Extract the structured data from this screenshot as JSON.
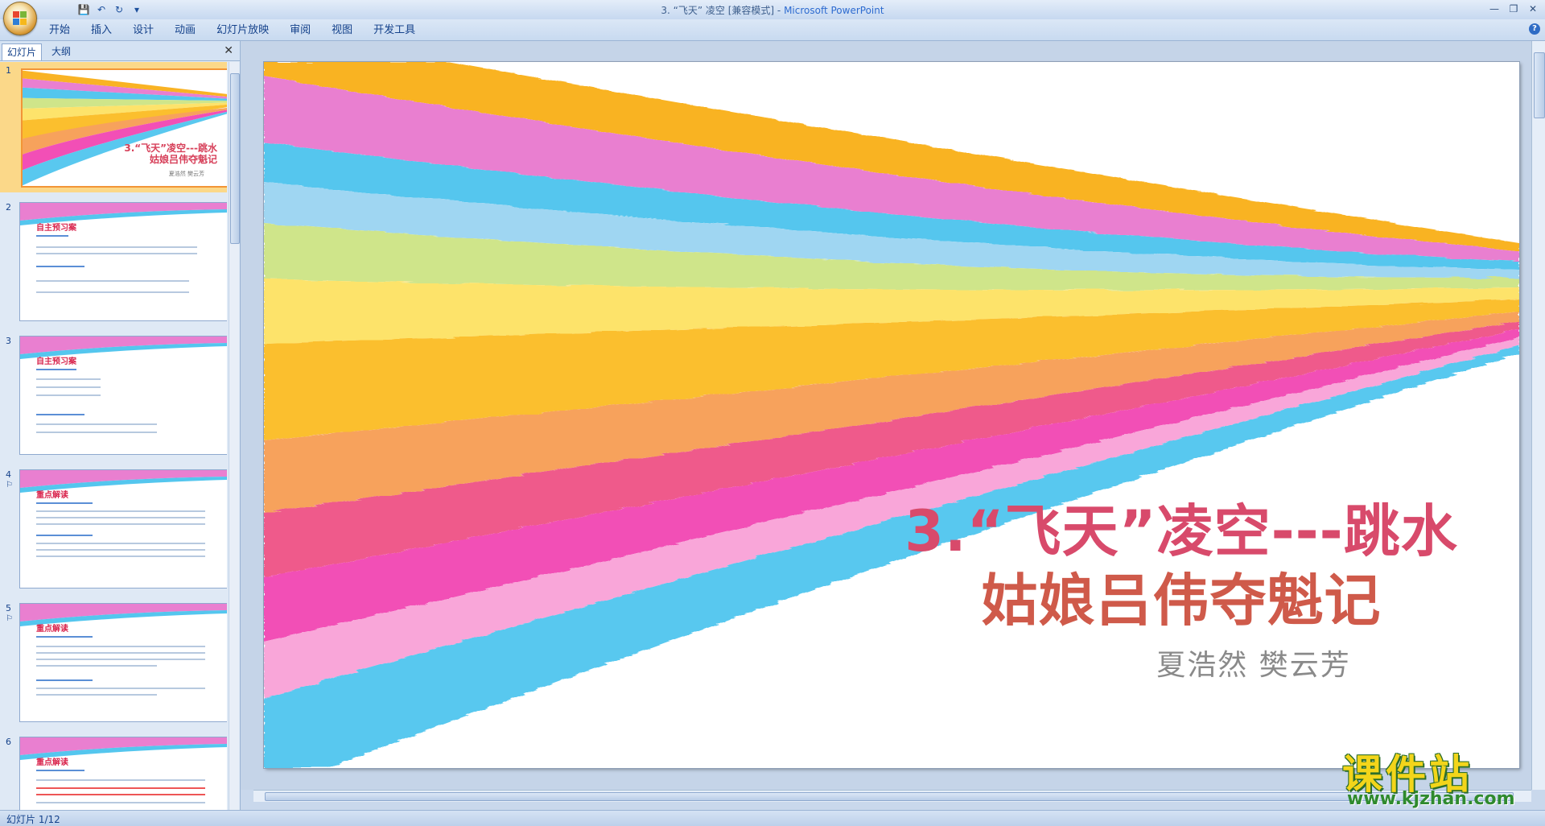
{
  "window": {
    "title_doc": "3. “飞天” 凌空 [兼容模式]",
    "title_sep": " - ",
    "title_app": "Microsoft PowerPoint",
    "minimize_glyph": "—",
    "restore_glyph": "❐",
    "close_glyph": "✕"
  },
  "qat": {
    "save_glyph": "💾",
    "undo_glyph": "↶",
    "redo_glyph": "↻",
    "customize_glyph": "▾"
  },
  "ribbon": {
    "tabs": [
      {
        "label": "开始"
      },
      {
        "label": "插入"
      },
      {
        "label": "设计"
      },
      {
        "label": "动画"
      },
      {
        "label": "幻灯片放映"
      },
      {
        "label": "审阅"
      },
      {
        "label": "视图"
      },
      {
        "label": "开发工具"
      }
    ],
    "help_glyph": "?"
  },
  "left_panel": {
    "tab_slides": "幻灯片",
    "tab_outline": "大纲",
    "close_glyph": "✕",
    "slides": [
      {
        "num": "1",
        "title": "3.“飞天”凌空---跳水",
        "title2": "姑娘吕伟夺魁记",
        "sub": "夏浩然  樊云芳"
      },
      {
        "num": "2",
        "title": "自主预习案"
      },
      {
        "num": "3",
        "title": "自主预习案"
      },
      {
        "num": "4",
        "note": "⚐",
        "title": "重点解读"
      },
      {
        "num": "5",
        "note": "⚐",
        "title": "重点解读"
      },
      {
        "num": "6",
        "title": "重点解读"
      }
    ]
  },
  "slide": {
    "title_line1": "3.“飞天”凌空---跳水",
    "title_line2": "姑娘吕伟夺魁记",
    "authors": "夏浩然  樊云芳"
  },
  "statusbar": {
    "text": "幻灯片 1/12"
  },
  "watermark": {
    "main": "课件站",
    "url": "www.kjzhan.com"
  },
  "colors": {
    "ribbon_bg": "#c8daf0",
    "selected_thumb_border": "#f29536",
    "title_red": "#d84a6b",
    "stripe_colors": [
      "#f9b324",
      "#e97fd0",
      "#54c6ee",
      "#9fd6f2",
      "#cfe58a",
      "#fde36b",
      "#fbbf2e",
      "#f7a25c",
      "#ef5a8b",
      "#f24fb6",
      "#f9a6d9",
      "#59c8ef"
    ]
  }
}
